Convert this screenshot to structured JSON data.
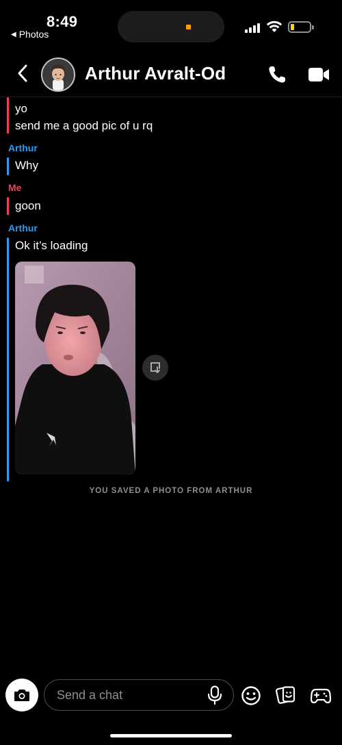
{
  "status_bar": {
    "time": "8:49",
    "back_app": "Photos",
    "recording_indicator_color": "#ff9f0a",
    "battery_color": "#ffd60a"
  },
  "header": {
    "contact_name": "Arthur Avralt-Od",
    "back_icon": "chevron-left-icon",
    "call_icon": "phone-icon",
    "video_icon": "video-camera-icon"
  },
  "colors": {
    "me": "#e8435a",
    "arthur": "#2d9cf0"
  },
  "messages": [
    {
      "sender": "",
      "text": "yo"
    },
    {
      "sender": "",
      "text": "send me a good pic of u rq"
    },
    {
      "sender": "Arthur",
      "text": "Why"
    },
    {
      "sender": "Me",
      "text": "goon"
    },
    {
      "sender": "Arthur",
      "text": "Ok it’s loading"
    }
  ],
  "saved_note": "YOU SAVED A PHOTO FROM ARTHUR",
  "composer": {
    "placeholder": "Send a chat",
    "camera_icon": "camera-icon",
    "mic_icon": "microphone-icon",
    "emoji_icon": "smiley-icon",
    "sticker_icon": "sticker-icon",
    "game_icon": "game-controller-icon"
  }
}
